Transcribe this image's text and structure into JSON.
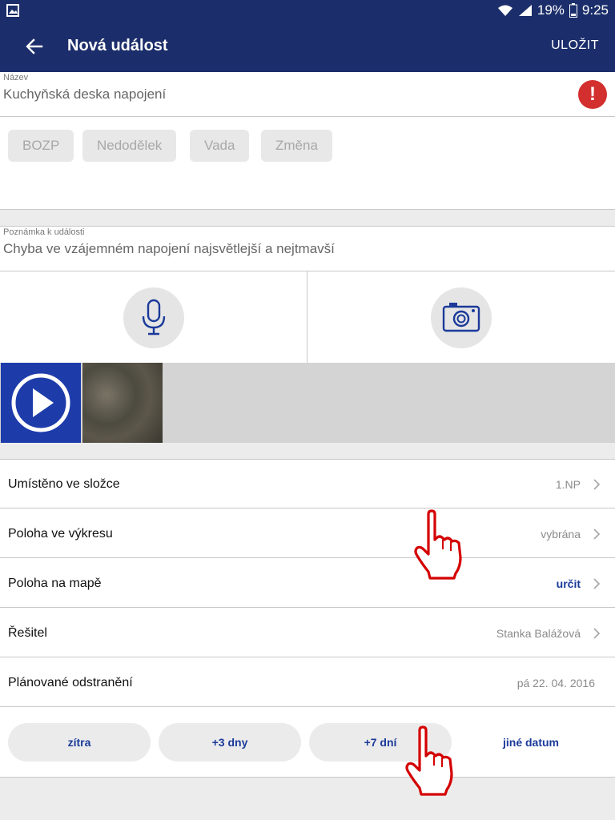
{
  "status_bar": {
    "battery": "19%",
    "time": "9:25"
  },
  "app_bar": {
    "title": "Nová událost",
    "save_label": "ULOŽIT"
  },
  "name_field": {
    "label": "Název",
    "value": "Kuchyňská deska napojení",
    "alert_glyph": "!"
  },
  "categories": [
    "BOZP",
    "Nedodělek",
    "Vada",
    "Změna"
  ],
  "note_field": {
    "label": "Poznámka k události",
    "value": "Chyba ve vzájemném napojení najsvětlejší a nejtmavší"
  },
  "rows": [
    {
      "label": "Umístěno ve složce",
      "value": "1.NP"
    },
    {
      "label": "Poloha ve výkresu",
      "value": "vybrána"
    },
    {
      "label": "Poloha na mapě",
      "value": "určit"
    },
    {
      "label": "Řešitel",
      "value": "Stanka Balážová"
    },
    {
      "label": "Plánované odstranění",
      "value": "pá 22. 04. 2016"
    }
  ],
  "date_options": [
    "zítra",
    "+3 dny",
    "+7 dní",
    "jiné datum"
  ],
  "colors": {
    "primary": "#1b2e6b",
    "accent": "#1b3a9a",
    "alert": "#d32f2f",
    "hand": "#d40000"
  }
}
